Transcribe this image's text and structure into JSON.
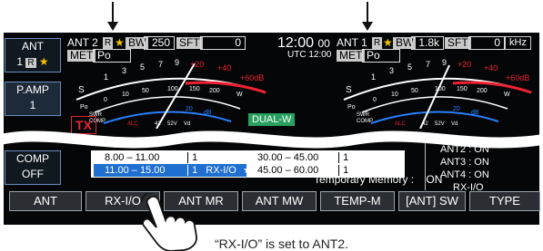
{
  "left_panel": {
    "ant_button": {
      "label": "ANT",
      "value": "1"
    },
    "pamp_button": {
      "label": "P.AMP",
      "value": "1"
    },
    "comp_button": {
      "label": "COMP",
      "value": "OFF"
    }
  },
  "left_header": {
    "ant": "ANT 2",
    "rx_badge": "R",
    "bw_label": "BW",
    "bw_value": "250",
    "sft_label": "SFT",
    "sft_value": "0",
    "met_label": "MET",
    "met_value": "Po"
  },
  "right_header": {
    "time_label": "12:00",
    "time_suffix": "00",
    "utc": "UTC 12:00",
    "ant": "ANT 1",
    "rx_badge": "R",
    "bw_label": "BW",
    "bw_value": "1.8k",
    "sft_label": "SFT",
    "sft_value": "0",
    "unit": "kHz",
    "met_label": "MET",
    "met_value": "Po"
  },
  "meter_scale": {
    "s_label": "S",
    "s_ticks": [
      "1",
      "3",
      "5",
      "7",
      "9",
      "+20",
      "+40",
      "+60dB"
    ],
    "po_ticks": [
      "0",
      "10",
      "50",
      "100",
      "150",
      "200",
      "W"
    ],
    "swr_ticks": [
      "1",
      "1.5",
      "2",
      "3",
      "∞"
    ],
    "comp_ticks": [
      "0",
      "10",
      "20",
      "dB"
    ],
    "bottom_labels": [
      "Po",
      "SWR",
      "COMP",
      "ALC",
      "42",
      "52V",
      "Vd"
    ]
  },
  "tx_badge": "TX",
  "dual_watch": "DUAL-W",
  "band_table": {
    "rows": [
      {
        "range": "8.00  –  11.00",
        "ant": "1",
        "rxio": "",
        "star": "",
        "selected": false
      },
      {
        "range": "11.00  –  15.00",
        "ant": "1",
        "rxio": "RX-I/O",
        "star": "★",
        "selected": true
      }
    ],
    "rows_right": [
      {
        "range": "30.00  –  45.00",
        "ant": "1"
      },
      {
        "range": "45.00  –  60.00",
        "ant": "1"
      }
    ]
  },
  "ant_status": [
    "ANT2 : ON",
    "ANT3 : ON",
    "ANT4 : ON",
    "RX-I/O"
  ],
  "temp_memory": {
    "label": "Temporary Memory :",
    "value": "ON"
  },
  "function_bar": [
    "ANT",
    "RX-I/O",
    "ANT MR",
    "ANT MW",
    "TEMP-M",
    "[ANT] SW",
    "TYPE"
  ],
  "caption": "“RX-I/O” is set to ANT2.",
  "colors": {
    "accent_red": "#e23333",
    "accent_green": "#28a060",
    "select_blue": "#1f6fd0"
  }
}
